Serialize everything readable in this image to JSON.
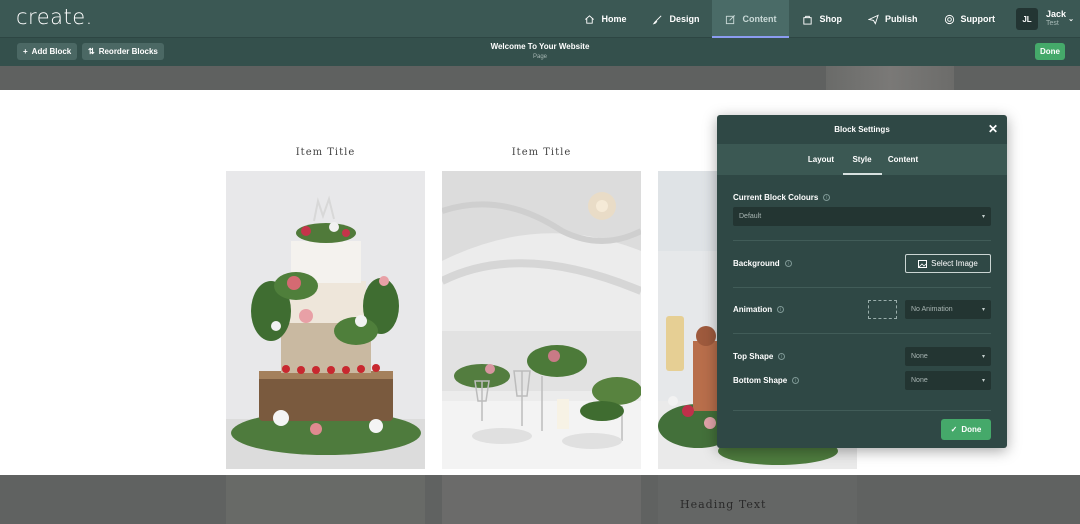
{
  "header": {
    "logo": "create.",
    "nav": [
      {
        "label": "Home",
        "icon": "home-icon"
      },
      {
        "label": "Design",
        "icon": "brush-icon"
      },
      {
        "label": "Content",
        "icon": "edit-icon",
        "active": true
      },
      {
        "label": "Shop",
        "icon": "bag-icon"
      },
      {
        "label": "Publish",
        "icon": "send-icon"
      },
      {
        "label": "Support",
        "icon": "lifebuoy-icon"
      }
    ],
    "user": {
      "initials": "JL",
      "name": "Jack",
      "sub": "Test"
    }
  },
  "toolbar": {
    "add_block": "Add Block",
    "reorder_blocks": "Reorder Blocks",
    "page_title": "Welcome To Your Website",
    "page_type": "Page",
    "done": "Done"
  },
  "content": {
    "items": [
      {
        "title": "Item Title",
        "image": "wedding-cake-photo"
      },
      {
        "title": "Item Title",
        "image": "tent-table-setting-photo"
      },
      {
        "title": "",
        "image": "dessert-table-photo"
      }
    ],
    "heading_text": "Heading Text"
  },
  "panel": {
    "title": "Block Settings",
    "tabs": [
      {
        "label": "Layout"
      },
      {
        "label": "Style",
        "active": true
      },
      {
        "label": "Content"
      }
    ],
    "current_block_colours_label": "Current Block Colours",
    "current_block_colours_value": "Default",
    "background_label": "Background",
    "select_image": "Select Image",
    "animation_label": "Animation",
    "animation_value": "No Animation",
    "top_shape_label": "Top Shape",
    "top_shape_value": "None",
    "bottom_shape_label": "Bottom Shape",
    "bottom_shape_value": "None",
    "done": "Done"
  },
  "colors": {
    "header_bg": "#3b5854",
    "panel_bg": "#2f4845",
    "accent_green": "#45a96a",
    "active_underline": "#8b9cf0"
  }
}
